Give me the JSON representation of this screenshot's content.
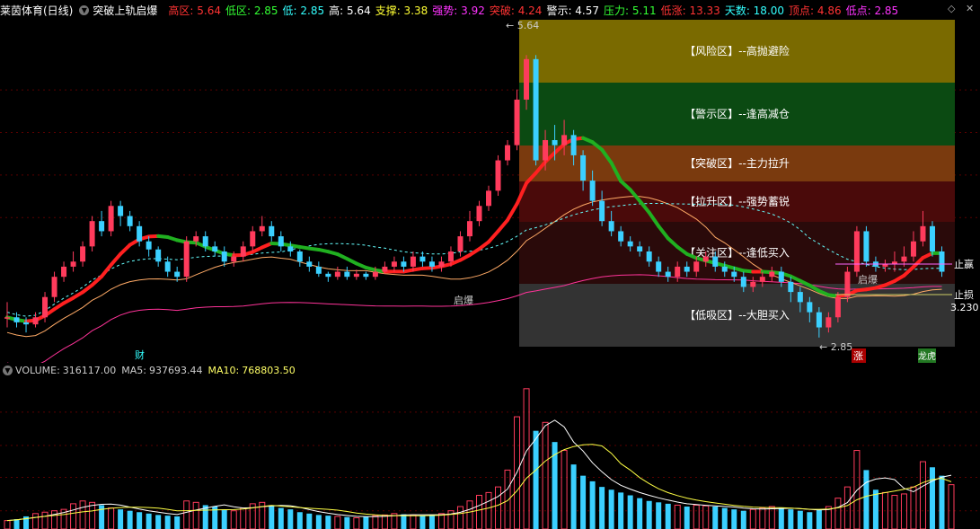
{
  "header": {
    "title": "莱茵体育(日线)",
    "indicator": "突破上轨启爆",
    "fields": [
      {
        "label": "高区:",
        "value": "5.64",
        "color": "#ff3333"
      },
      {
        "label": "低区:",
        "value": "2.85",
        "color": "#33ff33"
      },
      {
        "label": "低:",
        "value": "2.85",
        "color": "#33ffff"
      },
      {
        "label": "高:",
        "value": "5.64",
        "color": "#ffffff"
      },
      {
        "label": "支撑:",
        "value": "3.38",
        "color": "#ffff33"
      },
      {
        "label": "强势:",
        "value": "3.92",
        "color": "#ff33ff"
      },
      {
        "label": "突破:",
        "value": "4.24",
        "color": "#ff3333"
      },
      {
        "label": "警示:",
        "value": "4.57",
        "color": "#ffffff"
      },
      {
        "label": "压力:",
        "value": "5.11",
        "color": "#33ff33"
      },
      {
        "label": "低涨:",
        "value": "13.33",
        "color": "#ff3333"
      },
      {
        "label": "天数:",
        "value": "18.00",
        "color": "#33ffff"
      },
      {
        "label": "顶点:",
        "value": "4.86",
        "color": "#ff3333"
      },
      {
        "label": "低点:",
        "value": "2.85",
        "color": "#ff33ff"
      }
    ]
  },
  "zones": [
    {
      "label": "【风险区】--高抛避险",
      "color": "#7a6a00"
    },
    {
      "label": "【警示区】--逢高减仓",
      "color": "#0b4a12"
    },
    {
      "label": "【突破区】--主力拉升",
      "color": "#7a3a0e"
    },
    {
      "label": "【拉升区】--强势蓄锐",
      "color": "#4a0a0a"
    },
    {
      "label": "【关注区】--逢低买入",
      "color": "#2a0a0a"
    },
    {
      "label": "【低吸区】--大胆买入",
      "color": "#333333"
    }
  ],
  "annotations": {
    "high_mark": "5.64",
    "low_mark": "← 2.85",
    "qibao": "启爆",
    "qibao2": "启爆",
    "cai": "财",
    "zhang": "涨",
    "longhu": "龙虎",
    "take_profit": "止赢",
    "stop_loss": "止损",
    "stop_price": "3.230"
  },
  "volume": {
    "label": "VOLUME:",
    "value": "316117.00",
    "ma5_label": "MA5:",
    "ma5": "937693.44",
    "ma10_label": "MA10:",
    "ma10": "768803.50"
  },
  "colors": {
    "up": "#ff3b5c",
    "down": "#3bd0ff",
    "zone_bg": "#333333"
  },
  "chart_data": {
    "type": "candlestick",
    "ylim": [
      2.6,
      5.9
    ],
    "candles": [
      [
        3.05,
        3.05,
        3.2,
        2.95,
        1
      ],
      [
        3.05,
        3.0,
        3.1,
        2.95,
        0
      ],
      [
        3.0,
        2.98,
        3.05,
        2.9,
        0
      ],
      [
        2.98,
        3.05,
        3.1,
        2.95,
        1
      ],
      [
        3.05,
        3.25,
        3.3,
        3.0,
        1
      ],
      [
        3.25,
        3.45,
        3.5,
        3.2,
        1
      ],
      [
        3.45,
        3.55,
        3.6,
        3.4,
        1
      ],
      [
        3.55,
        3.6,
        3.7,
        3.5,
        1
      ],
      [
        3.6,
        3.75,
        3.8,
        3.55,
        1
      ],
      [
        3.75,
        4.0,
        4.05,
        3.7,
        1
      ],
      [
        4.0,
        3.9,
        4.1,
        3.85,
        0
      ],
      [
        3.9,
        4.15,
        4.2,
        3.85,
        1
      ],
      [
        4.15,
        4.05,
        4.2,
        3.95,
        0
      ],
      [
        4.05,
        3.95,
        4.1,
        3.9,
        0
      ],
      [
        3.95,
        3.8,
        4.0,
        3.75,
        0
      ],
      [
        3.8,
        3.72,
        3.85,
        3.65,
        0
      ],
      [
        3.72,
        3.6,
        3.75,
        3.55,
        0
      ],
      [
        3.6,
        3.5,
        3.65,
        3.45,
        0
      ],
      [
        3.5,
        3.45,
        3.55,
        3.4,
        0
      ],
      [
        3.45,
        3.8,
        3.85,
        3.4,
        1
      ],
      [
        3.8,
        3.85,
        3.9,
        3.75,
        1
      ],
      [
        3.85,
        3.75,
        3.9,
        3.7,
        0
      ],
      [
        3.75,
        3.7,
        3.8,
        3.65,
        0
      ],
      [
        3.7,
        3.6,
        3.75,
        3.55,
        0
      ],
      [
        3.6,
        3.65,
        3.7,
        3.55,
        1
      ],
      [
        3.65,
        3.75,
        3.8,
        3.6,
        1
      ],
      [
        3.75,
        3.9,
        3.95,
        3.7,
        1
      ],
      [
        3.9,
        3.95,
        4.05,
        3.85,
        1
      ],
      [
        3.95,
        3.85,
        4.0,
        3.8,
        0
      ],
      [
        3.85,
        3.75,
        3.9,
        3.7,
        0
      ],
      [
        3.75,
        3.7,
        3.8,
        3.65,
        0
      ],
      [
        3.7,
        3.6,
        3.72,
        3.55,
        0
      ],
      [
        3.6,
        3.55,
        3.65,
        3.5,
        0
      ],
      [
        3.55,
        3.48,
        3.6,
        3.45,
        0
      ],
      [
        3.48,
        3.45,
        3.5,
        3.4,
        0
      ],
      [
        3.45,
        3.5,
        3.55,
        3.42,
        1
      ],
      [
        3.5,
        3.45,
        3.55,
        3.42,
        0
      ],
      [
        3.45,
        3.48,
        3.52,
        3.42,
        1
      ],
      [
        3.48,
        3.45,
        3.5,
        3.42,
        0
      ],
      [
        3.45,
        3.5,
        3.55,
        3.42,
        1
      ],
      [
        3.5,
        3.55,
        3.6,
        3.48,
        1
      ],
      [
        3.55,
        3.6,
        3.65,
        3.5,
        1
      ],
      [
        3.6,
        3.55,
        3.65,
        3.5,
        0
      ],
      [
        3.55,
        3.65,
        3.7,
        3.5,
        1
      ],
      [
        3.65,
        3.6,
        3.7,
        3.55,
        0
      ],
      [
        3.6,
        3.55,
        3.65,
        3.5,
        0
      ],
      [
        3.55,
        3.6,
        3.65,
        3.5,
        1
      ],
      [
        3.6,
        3.7,
        3.75,
        3.55,
        1
      ],
      [
        3.7,
        3.85,
        3.9,
        3.65,
        1
      ],
      [
        3.85,
        4.0,
        4.1,
        3.8,
        1
      ],
      [
        4.0,
        4.15,
        4.2,
        3.95,
        1
      ],
      [
        4.15,
        4.3,
        4.35,
        4.1,
        1
      ],
      [
        4.3,
        4.6,
        4.65,
        4.25,
        1
      ],
      [
        4.6,
        4.75,
        4.8,
        4.55,
        1
      ],
      [
        4.75,
        5.2,
        5.3,
        4.7,
        1
      ],
      [
        5.2,
        5.6,
        5.64,
        5.1,
        1
      ],
      [
        5.6,
        4.6,
        5.64,
        4.55,
        0
      ],
      [
        4.6,
        4.8,
        4.9,
        4.5,
        1
      ],
      [
        4.8,
        4.75,
        4.95,
        4.6,
        0
      ],
      [
        4.75,
        4.85,
        5.0,
        4.65,
        1
      ],
      [
        4.85,
        4.65,
        4.9,
        4.55,
        0
      ],
      [
        4.65,
        4.4,
        4.7,
        4.3,
        0
      ],
      [
        4.4,
        4.2,
        4.5,
        4.15,
        0
      ],
      [
        4.2,
        4.0,
        4.3,
        3.95,
        0
      ],
      [
        4.0,
        3.9,
        4.1,
        3.85,
        0
      ],
      [
        3.9,
        3.8,
        3.95,
        3.75,
        0
      ],
      [
        3.8,
        3.75,
        3.85,
        3.7,
        0
      ],
      [
        3.75,
        3.7,
        3.8,
        3.65,
        0
      ],
      [
        3.7,
        3.6,
        3.75,
        3.55,
        0
      ],
      [
        3.6,
        3.5,
        3.65,
        3.45,
        0
      ],
      [
        3.5,
        3.45,
        3.55,
        3.4,
        0
      ],
      [
        3.45,
        3.55,
        3.6,
        3.4,
        1
      ],
      [
        3.55,
        3.5,
        3.6,
        3.45,
        0
      ],
      [
        3.5,
        3.6,
        3.65,
        3.45,
        1
      ],
      [
        3.6,
        3.65,
        3.7,
        3.55,
        1
      ],
      [
        3.65,
        3.55,
        3.7,
        3.5,
        0
      ],
      [
        3.55,
        3.5,
        3.6,
        3.45,
        0
      ],
      [
        3.5,
        3.45,
        3.55,
        3.4,
        0
      ],
      [
        3.45,
        3.35,
        3.5,
        3.3,
        0
      ],
      [
        3.35,
        3.4,
        3.45,
        3.3,
        1
      ],
      [
        3.4,
        3.45,
        3.5,
        3.35,
        1
      ],
      [
        3.45,
        3.5,
        3.55,
        3.4,
        1
      ],
      [
        3.5,
        3.4,
        3.55,
        3.35,
        0
      ],
      [
        3.4,
        3.3,
        3.45,
        3.2,
        0
      ],
      [
        3.3,
        3.2,
        3.35,
        3.1,
        0
      ],
      [
        3.2,
        3.1,
        3.25,
        3.0,
        0
      ],
      [
        3.1,
        2.95,
        3.15,
        2.85,
        0
      ],
      [
        2.95,
        3.05,
        3.1,
        2.9,
        1
      ],
      [
        3.05,
        3.25,
        3.3,
        3.0,
        1
      ],
      [
        3.25,
        3.5,
        3.55,
        3.2,
        1
      ],
      [
        3.5,
        3.9,
        3.95,
        3.45,
        1
      ],
      [
        3.9,
        3.6,
        3.95,
        3.55,
        0
      ],
      [
        3.6,
        3.55,
        3.65,
        3.5,
        0
      ],
      [
        3.55,
        3.58,
        3.62,
        3.5,
        1
      ],
      [
        3.58,
        3.6,
        3.7,
        3.5,
        1
      ],
      [
        3.6,
        3.65,
        3.75,
        3.55,
        1
      ],
      [
        3.65,
        3.8,
        3.9,
        3.6,
        1
      ],
      [
        3.8,
        3.95,
        4.1,
        3.75,
        1
      ],
      [
        3.95,
        3.7,
        4.0,
        3.65,
        0
      ],
      [
        3.7,
        3.5,
        3.75,
        3.45,
        0
      ]
    ],
    "volumes": [
      60,
      70,
      90,
      110,
      120,
      130,
      140,
      180,
      200,
      190,
      170,
      150,
      140,
      130,
      120,
      110,
      100,
      95,
      90,
      200,
      190,
      170,
      160,
      140,
      130,
      150,
      180,
      190,
      170,
      150,
      140,
      120,
      110,
      100,
      95,
      90,
      85,
      80,
      90,
      95,
      100,
      110,
      105,
      100,
      95,
      100,
      110,
      130,
      160,
      200,
      240,
      260,
      300,
      420,
      800,
      1000,
      700,
      760,
      620,
      560,
      460,
      380,
      340,
      300,
      280,
      260,
      240,
      220,
      200,
      190,
      180,
      170,
      160,
      170,
      165,
      160,
      150,
      140,
      130,
      140,
      150,
      160,
      150,
      140,
      130,
      120,
      140,
      160,
      220,
      300,
      560,
      420,
      280,
      260,
      240,
      250,
      300,
      480,
      440,
      380,
      316
    ]
  }
}
